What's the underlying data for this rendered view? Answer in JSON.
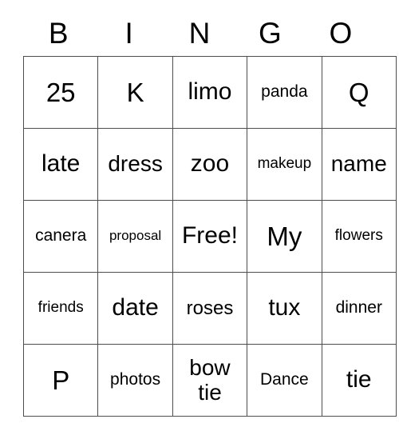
{
  "card": {
    "columns": [
      "B",
      "I",
      "N",
      "G",
      "O"
    ],
    "rows": [
      [
        {
          "text": "25",
          "size": "fs-xl"
        },
        {
          "text": "K",
          "size": "fs-xl"
        },
        {
          "text": "limo",
          "size": "fs-lg"
        },
        {
          "text": "panda",
          "size": "fs-xs"
        },
        {
          "text": "Q",
          "size": "fs-xl"
        }
      ],
      [
        {
          "text": "late",
          "size": "fs-lg"
        },
        {
          "text": "dress",
          "size": "fs-md"
        },
        {
          "text": "zoo",
          "size": "fs-lg"
        },
        {
          "text": "makeup",
          "size": "fs-xxs"
        },
        {
          "text": "name",
          "size": "fs-md"
        }
      ],
      [
        {
          "text": "canera",
          "size": "fs-xs"
        },
        {
          "text": "proposal",
          "size": "fs-tiny"
        },
        {
          "text": "Free!",
          "size": "fs-lg"
        },
        {
          "text": "My",
          "size": "fs-xl"
        },
        {
          "text": "flowers",
          "size": "fs-xxs"
        }
      ],
      [
        {
          "text": "friends",
          "size": "fs-xxs"
        },
        {
          "text": "date",
          "size": "fs-lg"
        },
        {
          "text": "roses",
          "size": "fs-sm"
        },
        {
          "text": "tux",
          "size": "fs-lg"
        },
        {
          "text": "dinner",
          "size": "fs-xs"
        }
      ],
      [
        {
          "text": "P",
          "size": "fs-xl"
        },
        {
          "text": "photos",
          "size": "fs-xs"
        },
        {
          "text": "bow tie",
          "size": "fs-md"
        },
        {
          "text": "Dance",
          "size": "fs-xs"
        },
        {
          "text": "tie",
          "size": "fs-lg"
        }
      ]
    ],
    "colors": {
      "text": "#000000",
      "grid_line": "#4d4d4d",
      "background": "#ffffff"
    }
  }
}
